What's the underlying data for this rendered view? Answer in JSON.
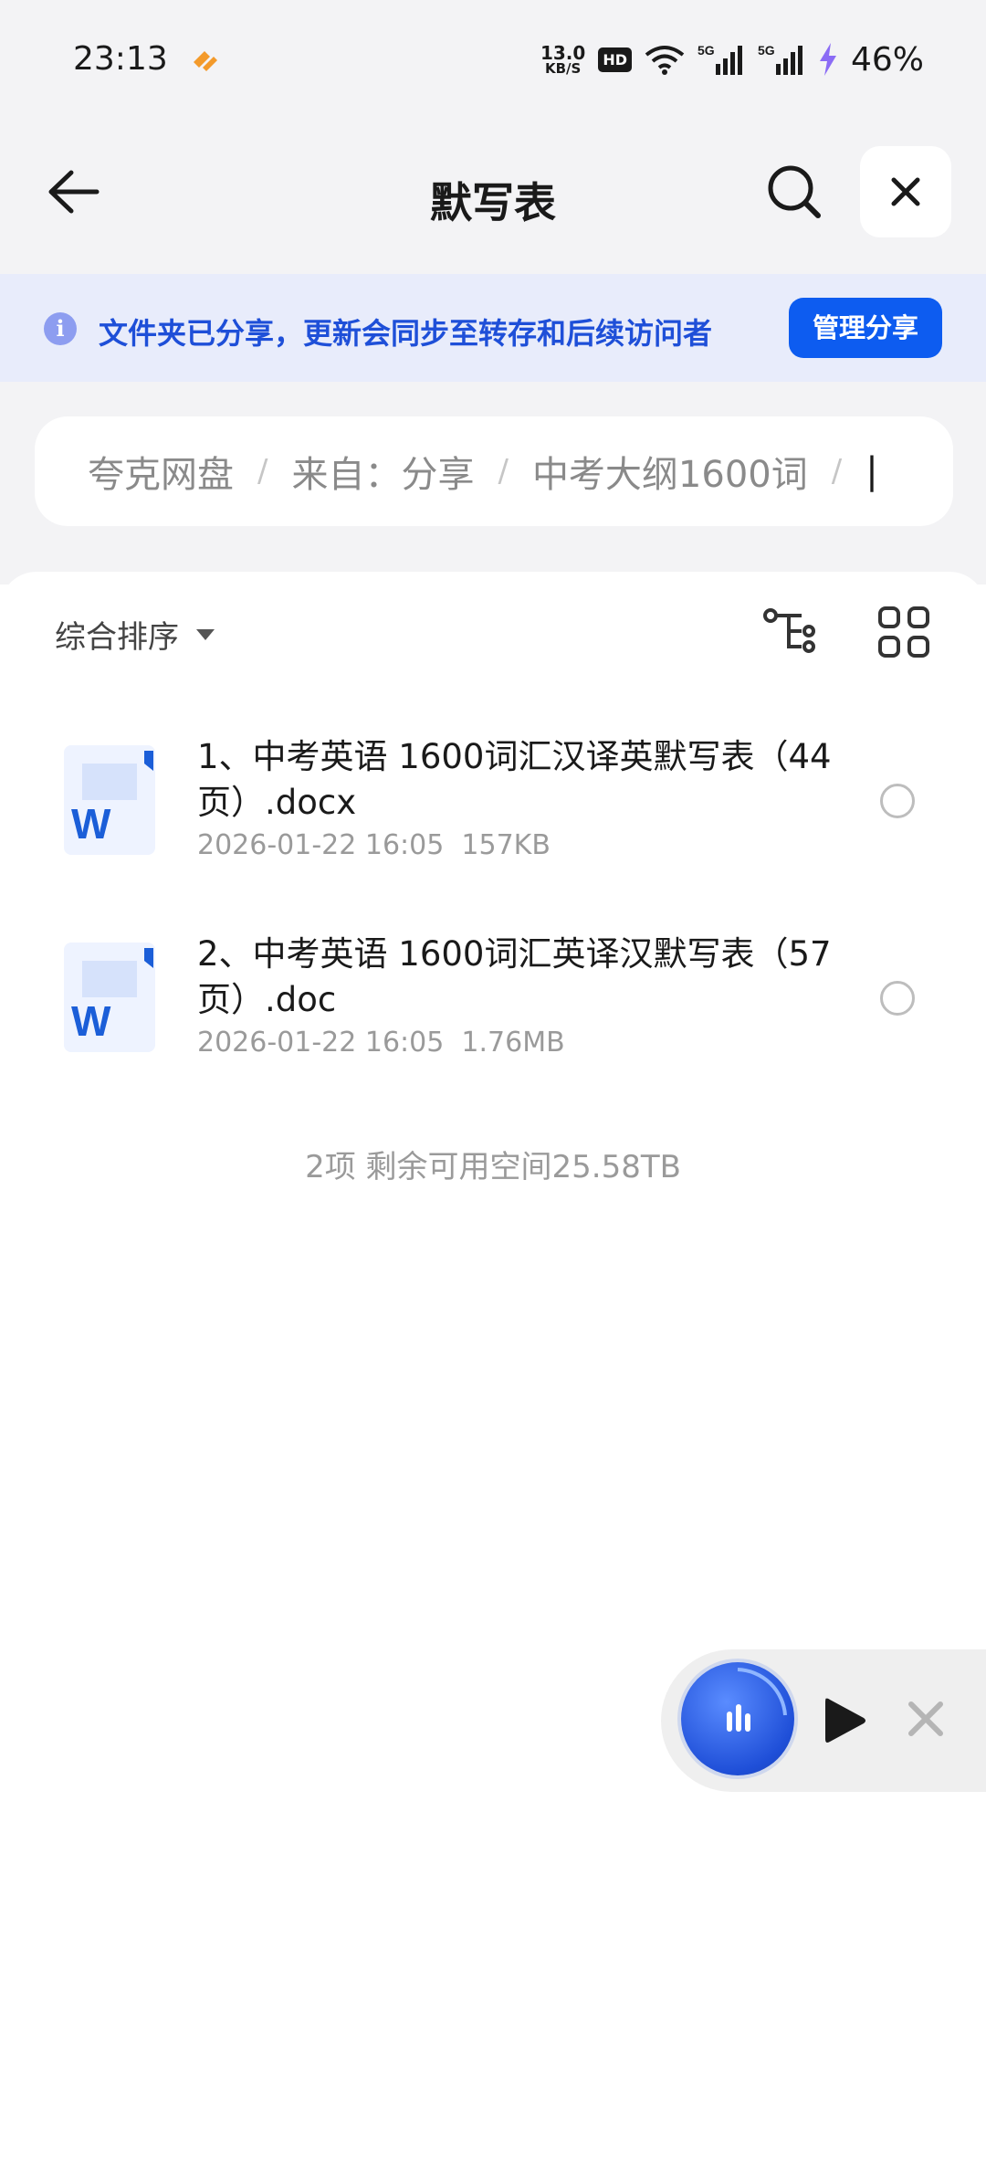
{
  "status_bar": {
    "time": "23:13",
    "net_speed_value": "13.0",
    "net_speed_unit": "KB/S",
    "hd_label": "HD",
    "network_1": "5G",
    "network_2": "5G",
    "battery": "46%"
  },
  "header": {
    "title": "默写表",
    "back_icon": "arrow-left-icon",
    "search_icon": "search-icon",
    "close_icon": "close-icon"
  },
  "share_banner": {
    "text": "文件夹已分享，更新会同步至转存和后续访问者",
    "button_label": "管理分享"
  },
  "breadcrumb": {
    "items": [
      "夸克网盘",
      "来自：分享",
      "中考大纲1600词",
      "|"
    ],
    "separator": "/"
  },
  "toolbar": {
    "sort_label": "综合排序"
  },
  "files": [
    {
      "name": "1、中考英语 1600词汇汉译英默写表（44页）.docx",
      "date": "2026-01-22 16:05",
      "size": "157KB",
      "icon": "word-doc-icon",
      "selected": false
    },
    {
      "name": "2、中考英语 1600词汇英译汉默写表（57页）.doc",
      "date": "2026-01-22 16:05",
      "size": "1.76MB",
      "icon": "word-doc-icon",
      "selected": false
    }
  ],
  "footer": {
    "summary": "2项 剩余可用空间25.58TB"
  },
  "colors": {
    "accent": "#0d5cf0",
    "banner_bg": "#e8ecfb",
    "banner_text": "#1e4fd8",
    "page_bg": "#f3f3f5"
  }
}
